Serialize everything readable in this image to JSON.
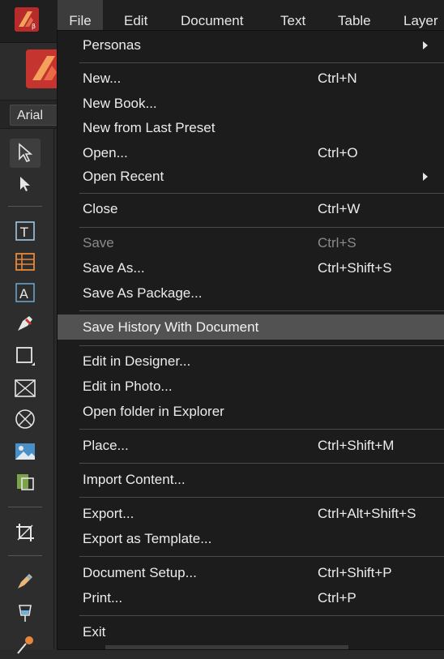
{
  "menubar": {
    "items": [
      {
        "label": "File"
      },
      {
        "label": "Edit"
      },
      {
        "label": "Document"
      },
      {
        "label": "Text"
      },
      {
        "label": "Table"
      },
      {
        "label": "Layer"
      }
    ]
  },
  "toolbar": {
    "font_name": "Arial"
  },
  "file_menu": {
    "items": [
      {
        "label": "Personas",
        "shortcut": ""
      },
      {
        "label": "New...",
        "shortcut": "Ctrl+N"
      },
      {
        "label": "New Book...",
        "shortcut": ""
      },
      {
        "label": "New from Last Preset",
        "shortcut": ""
      },
      {
        "label": "Open...",
        "shortcut": "Ctrl+O"
      },
      {
        "label": "Open Recent",
        "shortcut": ""
      },
      {
        "label": "Close",
        "shortcut": "Ctrl+W"
      },
      {
        "label": "Save",
        "shortcut": "Ctrl+S"
      },
      {
        "label": "Save As...",
        "shortcut": "Ctrl+Shift+S"
      },
      {
        "label": "Save As Package...",
        "shortcut": ""
      },
      {
        "label": "Save History With Document",
        "shortcut": ""
      },
      {
        "label": "Edit in Designer...",
        "shortcut": ""
      },
      {
        "label": "Edit in Photo...",
        "shortcut": ""
      },
      {
        "label": "Open folder in Explorer",
        "shortcut": ""
      },
      {
        "label": "Place...",
        "shortcut": "Ctrl+Shift+M"
      },
      {
        "label": "Import Content...",
        "shortcut": ""
      },
      {
        "label": "Export...",
        "shortcut": "Ctrl+Alt+Shift+S"
      },
      {
        "label": "Export as Template...",
        "shortcut": ""
      },
      {
        "label": "Document Setup...",
        "shortcut": "Ctrl+Shift+P"
      },
      {
        "label": "Print...",
        "shortcut": "Ctrl+P"
      },
      {
        "label": "Exit",
        "shortcut": ""
      }
    ]
  },
  "colors": {
    "menu_bg": "#1c1c1c",
    "highlight": "#525252",
    "accent_red": "#c5342f"
  }
}
